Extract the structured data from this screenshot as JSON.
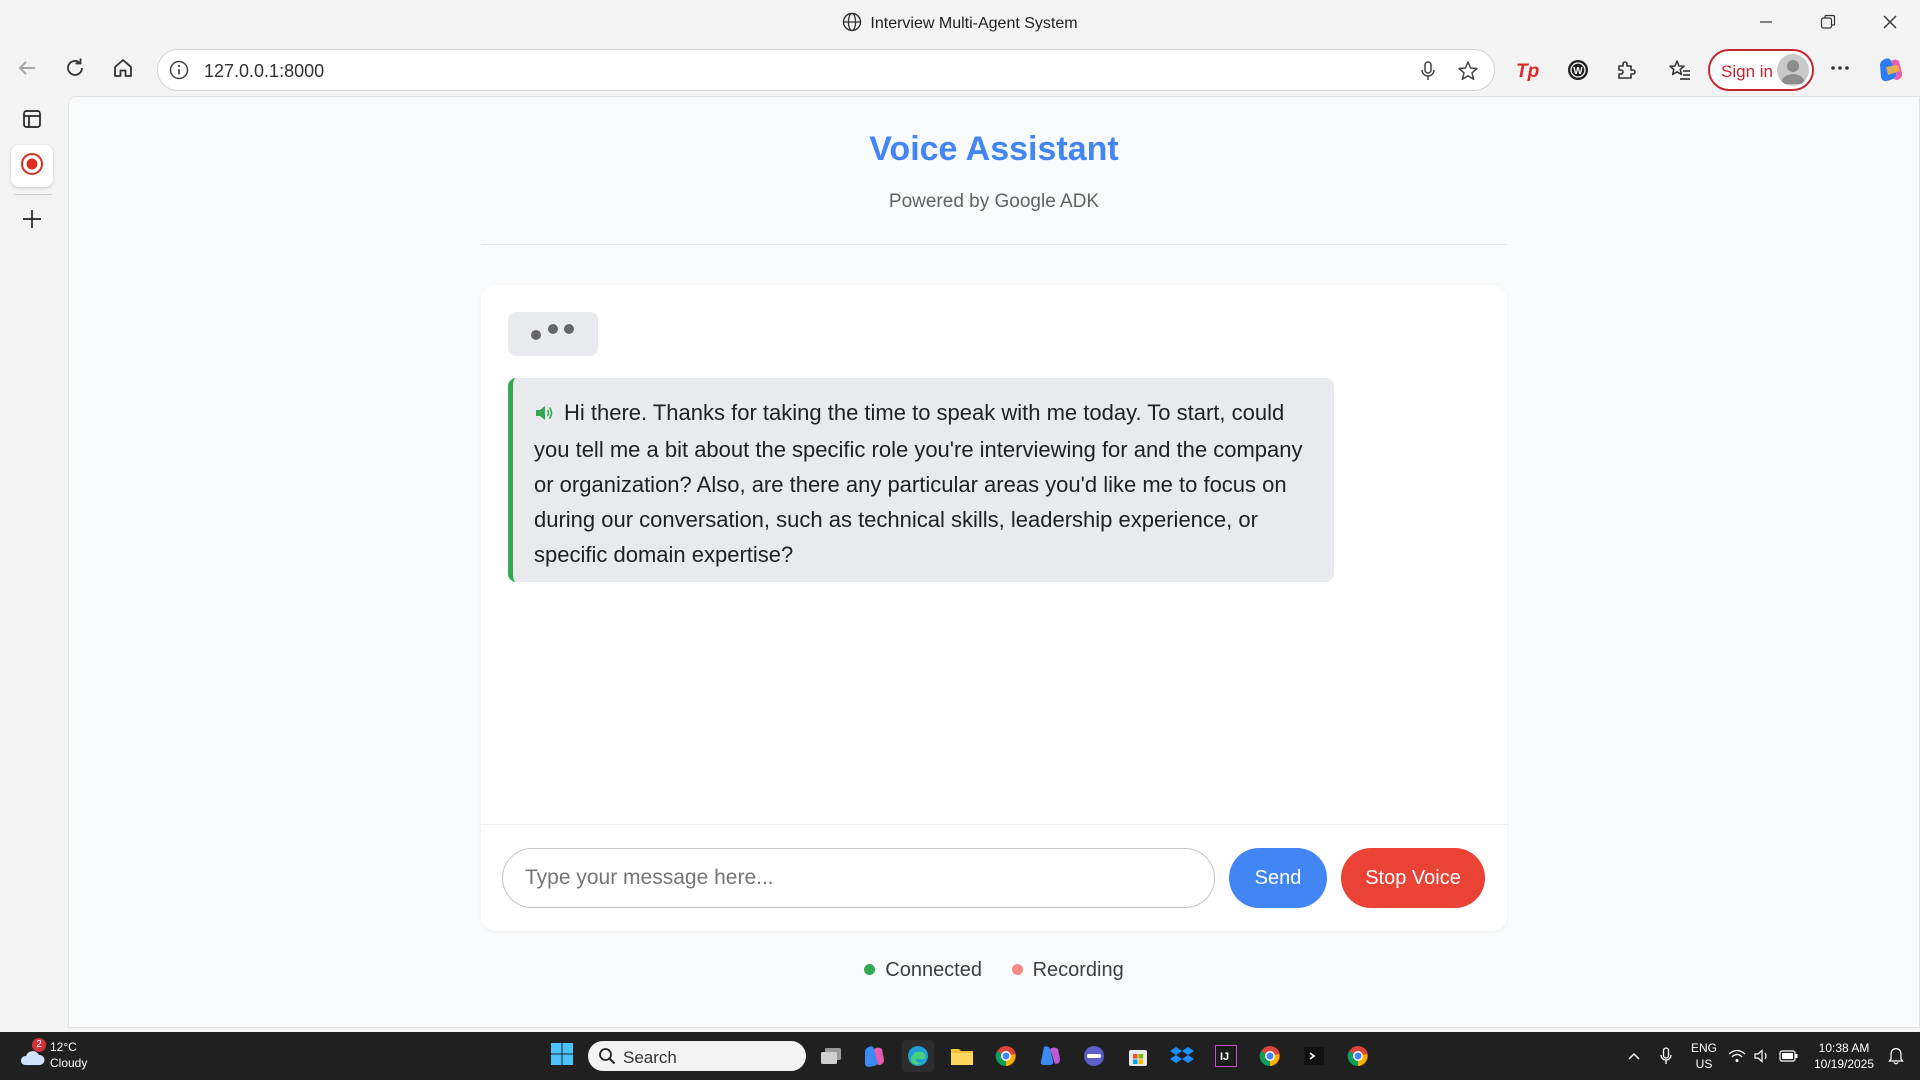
{
  "window": {
    "title": "Interview Multi-Agent System"
  },
  "browser": {
    "url": "127.0.0.1:8000",
    "signin_label": "Sign in"
  },
  "app": {
    "title": "Voice Assistant",
    "subtitle": "Powered by Google ADK",
    "messages": [
      {
        "role": "agent",
        "type": "audio-transcript",
        "text": "Hi there. Thanks for taking the time to speak with me today. To start, could you tell me a bit about the specific role you're interviewing for and the company or organization? Also, are there any particular areas you'd like me to focus on during our conversation, such as technical skills, leadership experience, or specific domain expertise?"
      }
    ],
    "input": {
      "placeholder": "Type your message here...",
      "value": ""
    },
    "send_label": "Send",
    "stop_voice_label": "Stop Voice",
    "status": {
      "connected_label": "Connected",
      "recording_label": "Recording"
    }
  },
  "taskbar": {
    "weather_temp": "12°C",
    "weather_condition": "Cloudy",
    "weather_badge": "2",
    "search_label": "Search",
    "language": "ENG",
    "region": "US",
    "time": "10:38 AM",
    "date": "10/19/2025"
  },
  "colors": {
    "primary": "#4285f4",
    "danger": "#ea4335",
    "success": "#34a853",
    "recording_dot": "#f28b82"
  }
}
